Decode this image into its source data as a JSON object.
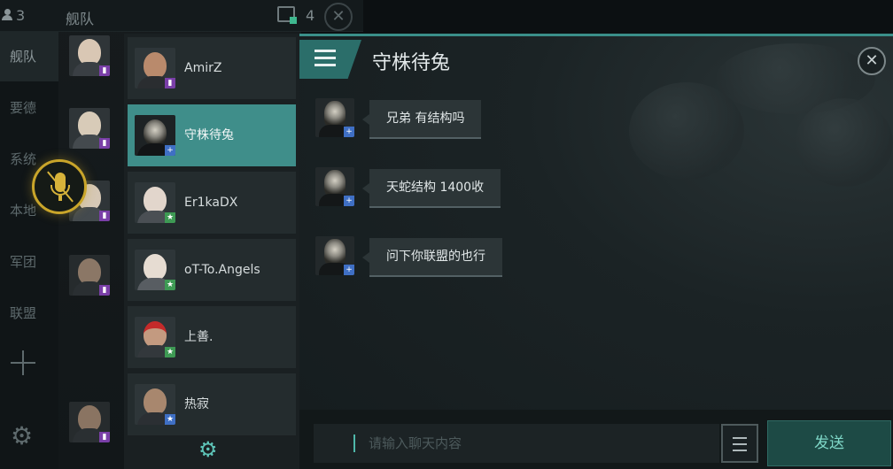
{
  "topbar": {
    "user_count": "3",
    "fleet_label": "舰队",
    "window_count": "4"
  },
  "side_nav": {
    "items": [
      "舰队",
      "要德",
      "系统",
      "本地",
      "军团",
      "联盟"
    ],
    "active": "舰队"
  },
  "contacts": [
    {
      "name": "AmirZ",
      "tag": "purple",
      "selected": false
    },
    {
      "name": "守株待兔",
      "tag": "blue",
      "selected": true
    },
    {
      "name": "Er1kaDX",
      "tag": "green",
      "selected": false
    },
    {
      "name": "oT-To.Angels",
      "tag": "green",
      "selected": false
    },
    {
      "name": "上善.",
      "tag": "green",
      "selected": false
    },
    {
      "name": "热寂",
      "tag": "blue",
      "selected": false
    }
  ],
  "chat": {
    "title": "守株待兔",
    "messages": [
      {
        "text": "兄弟 有结构吗"
      },
      {
        "text": "天蛇结构 1400收"
      },
      {
        "text": "问下你联盟的也行"
      }
    ],
    "input_placeholder": "请输入聊天内容",
    "input_value": "",
    "send_label": "发送"
  },
  "colors": {
    "accent": "#3f8e8a",
    "mic_ring": "#c9a52a",
    "send_text": "#7fd8c8"
  }
}
